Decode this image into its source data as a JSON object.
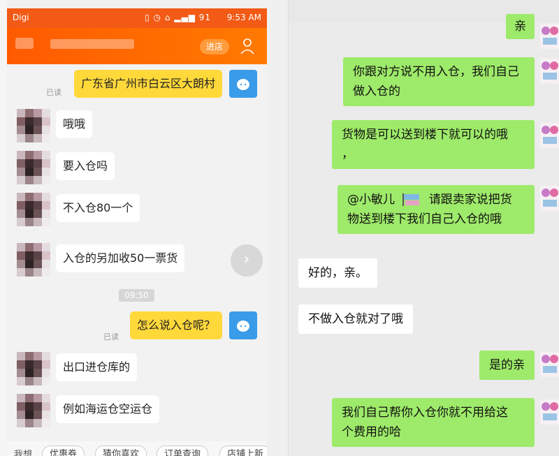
{
  "phone": {
    "status_bar": {
      "carrier": "Digi",
      "battery": "91",
      "time": "9:53 AM"
    },
    "header": {
      "enter_label": "进店"
    },
    "messages": [
      {
        "side": "right",
        "text": "广东省广州市白云区大朗村",
        "read": "已读"
      },
      {
        "side": "left",
        "text": "哦哦"
      },
      {
        "side": "left",
        "text": "要入仓吗"
      },
      {
        "side": "left",
        "text": "不入仓80一个"
      },
      {
        "side": "left",
        "text": "入仓的另加收50一票货"
      },
      {
        "side": "time",
        "text": "09:50"
      },
      {
        "side": "right",
        "text": "怎么说入仓呢？",
        "read": "已读"
      },
      {
        "side": "left",
        "text": "出口进仓库的"
      },
      {
        "side": "left",
        "text": "例如海运仓空运仓"
      }
    ],
    "bottom_bar": {
      "ask_label": "我想",
      "chips": [
        "优惠券",
        "猜你喜欢",
        "订单查询",
        "店铺上新"
      ]
    }
  },
  "desktop": {
    "messages": [
      {
        "side": "right",
        "lines": [
          "亲"
        ]
      },
      {
        "side": "right",
        "lines": [
          "你跟对方说不用入仓，我们自己",
          "做入仓的"
        ]
      },
      {
        "side": "right",
        "lines": [
          "货物是可以送到楼下就可以的哦",
          "，"
        ]
      },
      {
        "side": "right",
        "mention": "@小敏儿",
        "line1_rest": "请跟卖家说把货",
        "line2": "物送到楼下我们自己入仓的哦"
      },
      {
        "side": "left",
        "lines": [
          "好的，亲。"
        ]
      },
      {
        "side": "left",
        "lines": [
          "不做入仓就对了哦"
        ]
      },
      {
        "side": "right",
        "lines": [
          "是的亲"
        ]
      },
      {
        "side": "right",
        "lines": [
          "我们自己帮你入仓你就不用给这",
          "个费用的哈"
        ]
      }
    ]
  },
  "colors": {
    "phone_header": "#ff5a00",
    "seller_bubble": "#ffd83a",
    "wechat_green": "#9eea6a",
    "robot_avatar": "#3a9be8"
  },
  "icons": [
    "wechat-status-icon",
    "user-icon",
    "robot-avatar-icon",
    "next-arrow-icon",
    "emoji-avatar-icon"
  ]
}
